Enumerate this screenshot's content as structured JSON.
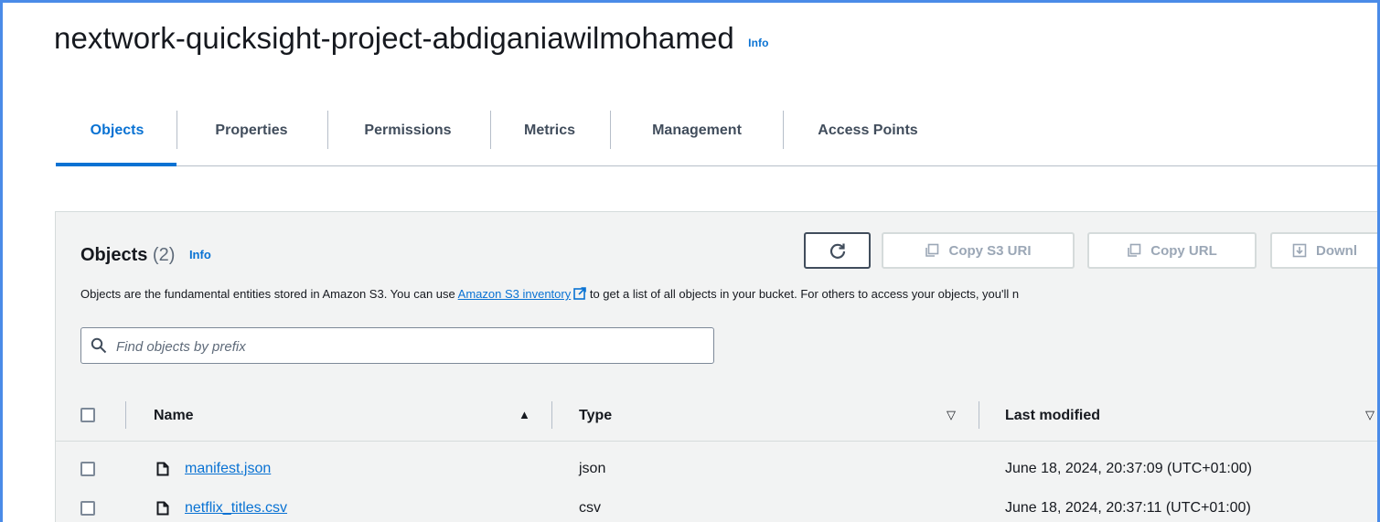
{
  "bucket": {
    "title": "nextwork-quicksight-project-abdiganiawilmohamed",
    "info": "Info"
  },
  "tabs": [
    {
      "label": "Objects",
      "active": true
    },
    {
      "label": "Properties"
    },
    {
      "label": "Permissions"
    },
    {
      "label": "Metrics"
    },
    {
      "label": "Management"
    },
    {
      "label": "Access Points"
    }
  ],
  "objects": {
    "heading": "Objects",
    "count": "(2)",
    "info": "Info",
    "description_before": "Objects are the fundamental entities stored in Amazon S3. You can use ",
    "description_link": "Amazon S3 inventory",
    "description_after": " to get a list of all objects in your bucket. For others to access your objects, you'll n",
    "search_placeholder": "Find objects by prefix",
    "buttons": {
      "copy_s3_uri": "Copy S3 URI",
      "copy_url": "Copy URL",
      "download": "Downl"
    }
  },
  "table": {
    "columns": {
      "name": "Name",
      "type": "Type",
      "last_modified": "Last modified"
    },
    "rows": [
      {
        "name": "manifest.json",
        "type": "json",
        "last_modified": "June 18, 2024, 20:37:09 (UTC+01:00)"
      },
      {
        "name": "netflix_titles.csv",
        "type": "csv",
        "last_modified": "June 18, 2024, 20:37:11 (UTC+01:00)"
      }
    ]
  },
  "colors": {
    "accent": "#0972d3",
    "frame": "#4a8be8",
    "panel_bg": "#f2f3f3",
    "disabled": "#9ba7b6"
  }
}
